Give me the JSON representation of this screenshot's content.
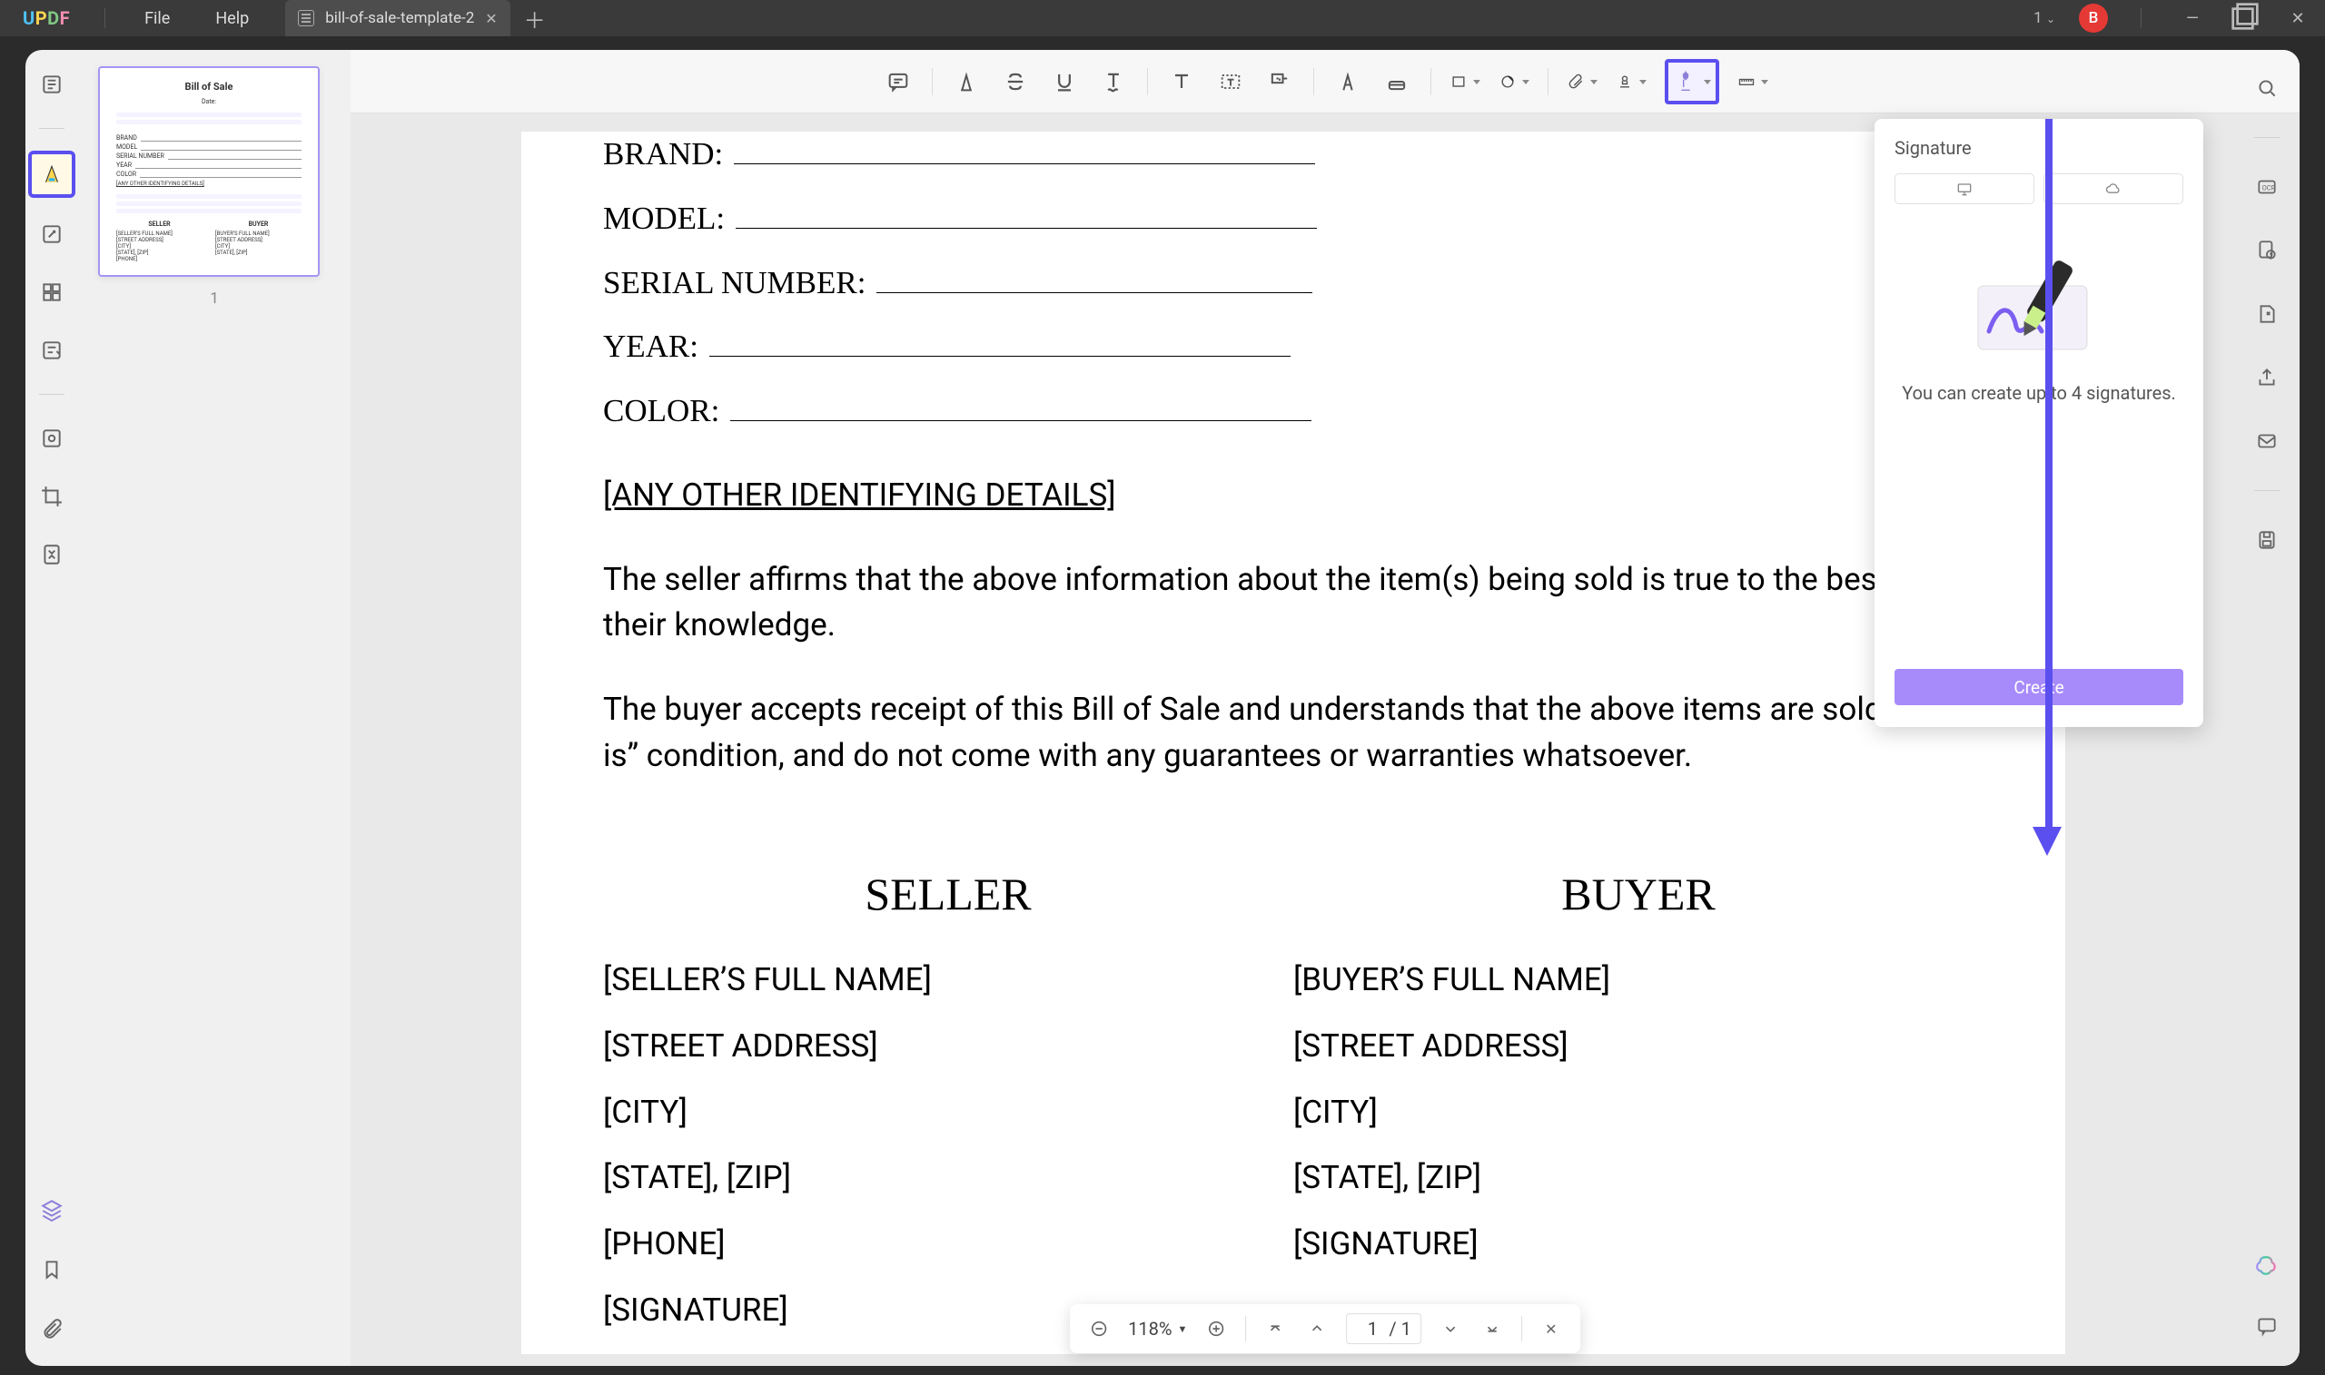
{
  "app": {
    "logo_letters": [
      "U",
      "P",
      "D",
      "F"
    ],
    "menu": {
      "file": "File",
      "help": "Help"
    },
    "tab_title": "bill-of-sale-template-2",
    "page_indicator": "1",
    "avatar_letter": "B"
  },
  "left_rail": {
    "thumbnail_number": "1"
  },
  "toolbar": {
    "items": [
      "comment",
      "highlight",
      "strikethrough",
      "underline",
      "text",
      "text-box",
      "insert-text",
      "text-callout",
      "pencil",
      "eraser",
      "rectangle",
      "shape",
      "attachment",
      "stamp",
      "signature",
      "ruler"
    ]
  },
  "signature_panel": {
    "title": "Signature",
    "help_text": "You can create up to 4 signatures.",
    "create_label": "Create"
  },
  "document": {
    "fields": {
      "brand": "BRAND:",
      "model": "MODEL:",
      "serial": "SERIAL NUMBER:",
      "year": "YEAR:",
      "color": "COLOR:",
      "other": "[ANY OTHER IDENTIFYING DETAILS]"
    },
    "para1": "The seller affirms that the above information about the item(s) being sold is true to the best of their knowledge.",
    "para2": "The buyer accepts receipt of this Bill of Sale and understands that the above items are sold in “as is” condition, and do not come with any guarantees or warranties whatsoever.",
    "seller": {
      "heading": "SELLER",
      "rows": [
        "[SELLER’S FULL NAME]",
        "[STREET ADDRESS]",
        "[CITY]",
        "[STATE], [ZIP]",
        "[PHONE]",
        "[SIGNATURE]"
      ]
    },
    "buyer": {
      "heading": "BUYER",
      "rows": [
        "[BUYER’S FULL NAME]",
        "[STREET ADDRESS]",
        "[CITY]",
        "[STATE], [ZIP]",
        "",
        "[SIGNATURE]"
      ]
    }
  },
  "zoom_bar": {
    "zoom": "118%",
    "page_current": "1",
    "page_sep": "/",
    "page_total": "1"
  },
  "thumbnail": {
    "title": "Bill of Sale",
    "date": "Date:",
    "seller_h": "SELLER",
    "buyer_h": "BUYER"
  }
}
